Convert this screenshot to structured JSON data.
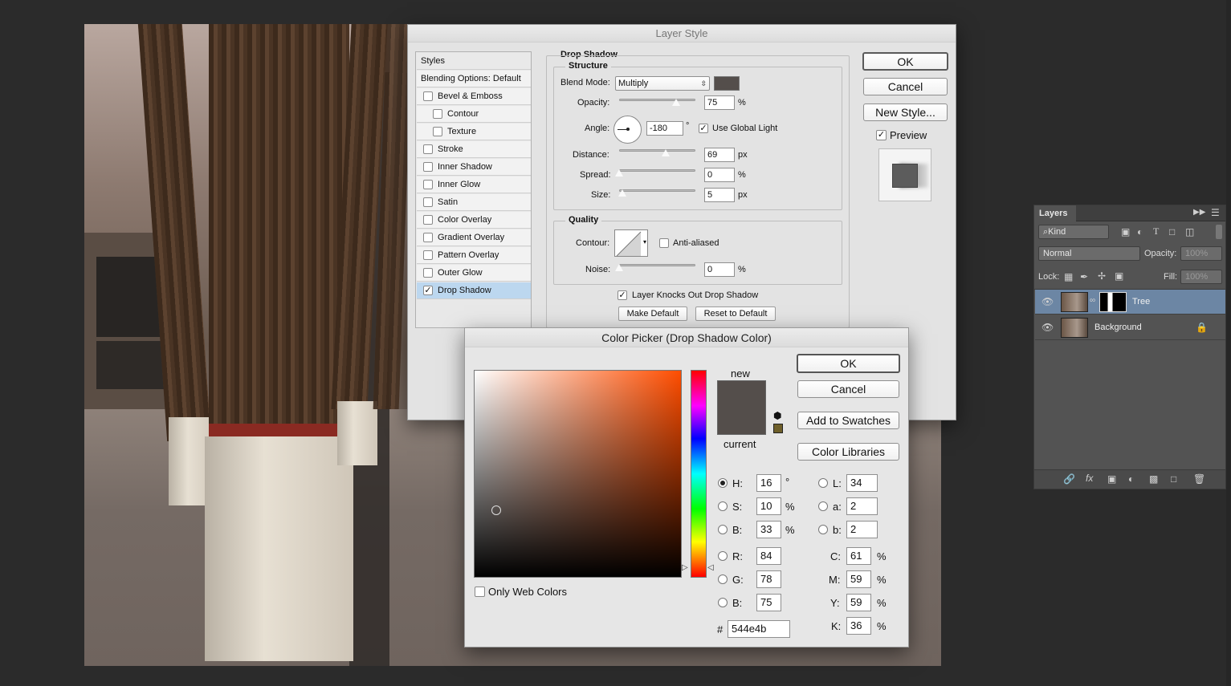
{
  "layer_style": {
    "title": "Layer Style",
    "styles_header": "Styles",
    "blending_options": "Blending Options: Default",
    "items": [
      {
        "label": "Bevel & Emboss",
        "checked": false,
        "indent": false
      },
      {
        "label": "Contour",
        "checked": false,
        "indent": true
      },
      {
        "label": "Texture",
        "checked": false,
        "indent": true
      },
      {
        "label": "Stroke",
        "checked": false,
        "indent": false
      },
      {
        "label": "Inner Shadow",
        "checked": false,
        "indent": false
      },
      {
        "label": "Inner Glow",
        "checked": false,
        "indent": false
      },
      {
        "label": "Satin",
        "checked": false,
        "indent": false
      },
      {
        "label": "Color Overlay",
        "checked": false,
        "indent": false
      },
      {
        "label": "Gradient Overlay",
        "checked": false,
        "indent": false
      },
      {
        "label": "Pattern Overlay",
        "checked": false,
        "indent": false
      },
      {
        "label": "Outer Glow",
        "checked": false,
        "indent": false
      },
      {
        "label": "Drop Shadow",
        "checked": true,
        "indent": false
      }
    ],
    "section_title": "Drop Shadow",
    "structure_title": "Structure",
    "blend_mode_label": "Blend Mode:",
    "blend_mode_value": "Multiply",
    "shadow_color": "#544e4b",
    "opacity_label": "Opacity:",
    "opacity_value": "75",
    "opacity_level": 0.75,
    "percent": "%",
    "angle_label": "Angle:",
    "angle_value": "-180",
    "degree": "°",
    "use_global_light": "Use Global Light",
    "distance_label": "Distance:",
    "distance_value": "69",
    "px": "px",
    "spread_label": "Spread:",
    "spread_value": "0",
    "size_label": "Size:",
    "size_value": "5",
    "quality_title": "Quality",
    "contour_label": "Contour:",
    "anti_aliased": "Anti-aliased",
    "noise_label": "Noise:",
    "noise_value": "0",
    "knocks_out": "Layer Knocks Out Drop Shadow",
    "make_default": "Make Default",
    "reset_default": "Reset to Default",
    "ok": "OK",
    "cancel": "Cancel",
    "new_style": "New Style...",
    "preview": "Preview"
  },
  "color_picker": {
    "title": "Color Picker (Drop Shadow Color)",
    "ok": "OK",
    "cancel": "Cancel",
    "add_to_swatches": "Add to Swatches",
    "color_libraries": "Color Libraries",
    "new_label": "new",
    "current_label": "current",
    "new_color": "#544e4b",
    "current_color": "#544e4b",
    "only_web_colors": "Only Web Colors",
    "h_label": "H:",
    "h_value": "16",
    "h_unit": "°",
    "s_label": "S:",
    "s_value": "10",
    "s_unit": "%",
    "b_label": "B:",
    "b_value": "33",
    "b_unit": "%",
    "r_label": "R:",
    "r_value": "84",
    "g_label": "G:",
    "g_value": "78",
    "bl_label": "B:",
    "bl_value": "75",
    "l_label": "L:",
    "l_value": "34",
    "a_label": "a:",
    "a_value": "2",
    "lb_label": "b:",
    "lb_value": "2",
    "c_label": "C:",
    "c_value": "61",
    "m_label": "M:",
    "m_value": "59",
    "y_label": "Y:",
    "y_value": "59",
    "k_label": "K:",
    "k_value": "36",
    "pct": "%",
    "hash": "#",
    "hex_value": "544e4b"
  },
  "layers_panel": {
    "title": "Layers",
    "kind": "Kind",
    "blend": "Normal",
    "opacity_label": "Opacity:",
    "opacity_value": "100%",
    "lock_label": "Lock:",
    "fill_label": "Fill:",
    "fill_value": "100%",
    "layers": [
      {
        "name": "Tree",
        "selected": true
      },
      {
        "name": "Background",
        "selected": false
      }
    ]
  }
}
